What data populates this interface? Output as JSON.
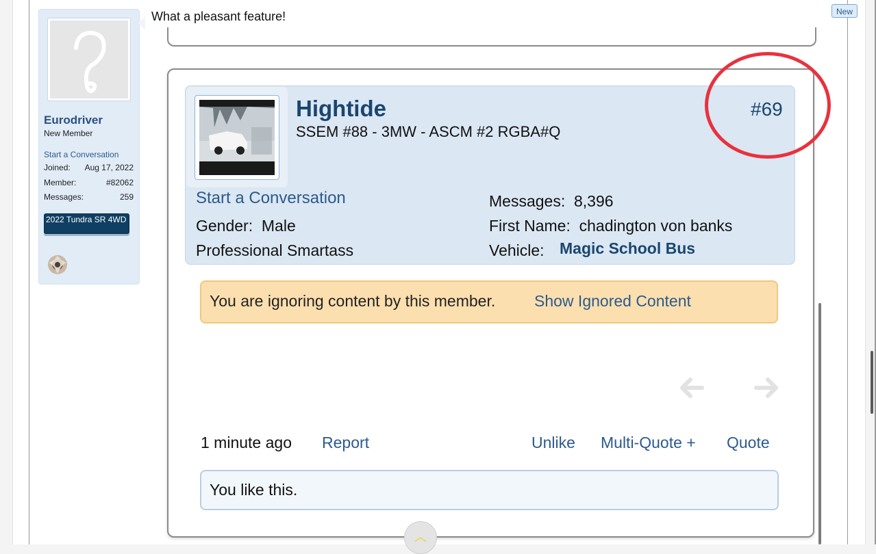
{
  "message": {
    "text": "What a pleasant feature!",
    "new_badge": "New"
  },
  "left_member": {
    "name": "Eurodriver",
    "title": "New Member",
    "conversation_link": "Start a Conversation",
    "stats": [
      {
        "label": "Joined:",
        "value": "Aug 17, 2022"
      },
      {
        "label": "Member:",
        "value": "#82062"
      },
      {
        "label": "Messages:",
        "value": "259"
      }
    ],
    "vehicle": "2022 Tundra SR 4WD"
  },
  "post": {
    "username": "Hightide",
    "signature": "SSEM #88 - 3MW - ASCM #2 RGBA#Q",
    "post_number": "#69",
    "conversation_link": "Start a Conversation",
    "gender_label": "Gender:",
    "gender_value": "Male",
    "custom_title": "Professional Smartass",
    "messages_label": "Messages:",
    "messages_value": "8,396",
    "first_name_label": "First Name:",
    "first_name_value": "chadington von banks",
    "vehicle_label": "Vehicle:",
    "vehicle_value": "Magic School Bus",
    "ignore_notice": "You are ignoring content by this member.",
    "ignore_link": "Show Ignored Content",
    "time": "1 minute ago",
    "report": "Report",
    "unlike": "Unlike",
    "multi_quote": "Multi-Quote +",
    "quote": "Quote",
    "likes_summary": "You like this."
  },
  "colors": {
    "link": "#2c5a8c",
    "header_bg": "#dbe7f3",
    "ignore_bg": "#fcdfaf",
    "annotation": "#e8323e"
  },
  "icons": [
    "question-mark-avatar-icon",
    "badge-icon",
    "arrow-left-icon",
    "arrow-right-icon",
    "chevron-up-icon"
  ]
}
